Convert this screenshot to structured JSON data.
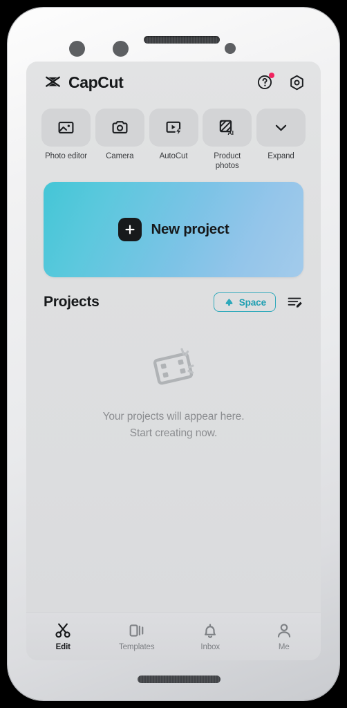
{
  "app": {
    "brand_name": "CapCut",
    "logo_icon": "capcut-logo-icon"
  },
  "header": {
    "help_icon": "help-circle-icon",
    "help_badge": true,
    "settings_icon": "hexagon-settings-icon"
  },
  "tools": [
    {
      "id": "photo-editor",
      "label": "Photo editor",
      "icon": "image-edit-icon"
    },
    {
      "id": "camera",
      "label": "Camera",
      "icon": "camera-icon"
    },
    {
      "id": "autocut",
      "label": "AutoCut",
      "icon": "video-flash-icon"
    },
    {
      "id": "product-photos",
      "label": "Product\nphotos",
      "label_line1": "Product",
      "label_line2": "photos",
      "icon": "ai-square-icon"
    },
    {
      "id": "expand",
      "label": "Expand",
      "icon": "chevron-down-icon"
    }
  ],
  "banner": {
    "label": "New project",
    "plus_icon": "plus-icon",
    "gradient_start": "#44c6d6",
    "gradient_end": "#a3cbeb"
  },
  "projects": {
    "title": "Projects",
    "space_button": {
      "label": "Space",
      "icon": "cloud-icon",
      "accent_color": "#2fa9bb"
    },
    "sort_icon": "list-edit-icon",
    "empty_state": {
      "art_icon": "film-strip-icon",
      "line1": "Your projects will appear here.",
      "line2": "Start creating now."
    }
  },
  "bottom_nav": {
    "active": "edit",
    "items": [
      {
        "id": "edit",
        "label": "Edit",
        "icon": "scissors-icon",
        "active": true
      },
      {
        "id": "templates",
        "label": "Templates",
        "icon": "templates-icon",
        "active": false
      },
      {
        "id": "inbox",
        "label": "Inbox",
        "icon": "bell-icon",
        "active": false
      },
      {
        "id": "me",
        "label": "Me",
        "icon": "person-icon",
        "active": false
      }
    ]
  }
}
